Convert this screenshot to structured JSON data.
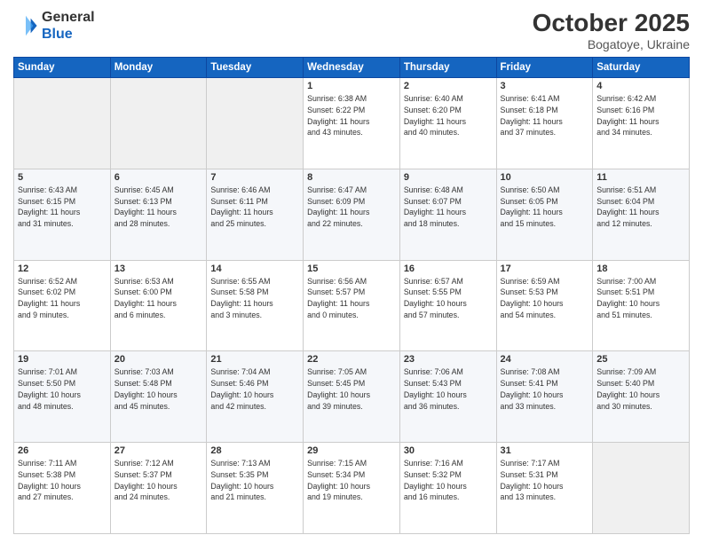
{
  "logo": {
    "line1": "General",
    "line2": "Blue"
  },
  "header": {
    "month": "October 2025",
    "location": "Bogatoye, Ukraine"
  },
  "weekdays": [
    "Sunday",
    "Monday",
    "Tuesday",
    "Wednesday",
    "Thursday",
    "Friday",
    "Saturday"
  ],
  "weeks": [
    [
      {
        "day": "",
        "text": ""
      },
      {
        "day": "",
        "text": ""
      },
      {
        "day": "",
        "text": ""
      },
      {
        "day": "1",
        "text": "Sunrise: 6:38 AM\nSunset: 6:22 PM\nDaylight: 11 hours\nand 43 minutes."
      },
      {
        "day": "2",
        "text": "Sunrise: 6:40 AM\nSunset: 6:20 PM\nDaylight: 11 hours\nand 40 minutes."
      },
      {
        "day": "3",
        "text": "Sunrise: 6:41 AM\nSunset: 6:18 PM\nDaylight: 11 hours\nand 37 minutes."
      },
      {
        "day": "4",
        "text": "Sunrise: 6:42 AM\nSunset: 6:16 PM\nDaylight: 11 hours\nand 34 minutes."
      }
    ],
    [
      {
        "day": "5",
        "text": "Sunrise: 6:43 AM\nSunset: 6:15 PM\nDaylight: 11 hours\nand 31 minutes."
      },
      {
        "day": "6",
        "text": "Sunrise: 6:45 AM\nSunset: 6:13 PM\nDaylight: 11 hours\nand 28 minutes."
      },
      {
        "day": "7",
        "text": "Sunrise: 6:46 AM\nSunset: 6:11 PM\nDaylight: 11 hours\nand 25 minutes."
      },
      {
        "day": "8",
        "text": "Sunrise: 6:47 AM\nSunset: 6:09 PM\nDaylight: 11 hours\nand 22 minutes."
      },
      {
        "day": "9",
        "text": "Sunrise: 6:48 AM\nSunset: 6:07 PM\nDaylight: 11 hours\nand 18 minutes."
      },
      {
        "day": "10",
        "text": "Sunrise: 6:50 AM\nSunset: 6:05 PM\nDaylight: 11 hours\nand 15 minutes."
      },
      {
        "day": "11",
        "text": "Sunrise: 6:51 AM\nSunset: 6:04 PM\nDaylight: 11 hours\nand 12 minutes."
      }
    ],
    [
      {
        "day": "12",
        "text": "Sunrise: 6:52 AM\nSunset: 6:02 PM\nDaylight: 11 hours\nand 9 minutes."
      },
      {
        "day": "13",
        "text": "Sunrise: 6:53 AM\nSunset: 6:00 PM\nDaylight: 11 hours\nand 6 minutes."
      },
      {
        "day": "14",
        "text": "Sunrise: 6:55 AM\nSunset: 5:58 PM\nDaylight: 11 hours\nand 3 minutes."
      },
      {
        "day": "15",
        "text": "Sunrise: 6:56 AM\nSunset: 5:57 PM\nDaylight: 11 hours\nand 0 minutes."
      },
      {
        "day": "16",
        "text": "Sunrise: 6:57 AM\nSunset: 5:55 PM\nDaylight: 10 hours\nand 57 minutes."
      },
      {
        "day": "17",
        "text": "Sunrise: 6:59 AM\nSunset: 5:53 PM\nDaylight: 10 hours\nand 54 minutes."
      },
      {
        "day": "18",
        "text": "Sunrise: 7:00 AM\nSunset: 5:51 PM\nDaylight: 10 hours\nand 51 minutes."
      }
    ],
    [
      {
        "day": "19",
        "text": "Sunrise: 7:01 AM\nSunset: 5:50 PM\nDaylight: 10 hours\nand 48 minutes."
      },
      {
        "day": "20",
        "text": "Sunrise: 7:03 AM\nSunset: 5:48 PM\nDaylight: 10 hours\nand 45 minutes."
      },
      {
        "day": "21",
        "text": "Sunrise: 7:04 AM\nSunset: 5:46 PM\nDaylight: 10 hours\nand 42 minutes."
      },
      {
        "day": "22",
        "text": "Sunrise: 7:05 AM\nSunset: 5:45 PM\nDaylight: 10 hours\nand 39 minutes."
      },
      {
        "day": "23",
        "text": "Sunrise: 7:06 AM\nSunset: 5:43 PM\nDaylight: 10 hours\nand 36 minutes."
      },
      {
        "day": "24",
        "text": "Sunrise: 7:08 AM\nSunset: 5:41 PM\nDaylight: 10 hours\nand 33 minutes."
      },
      {
        "day": "25",
        "text": "Sunrise: 7:09 AM\nSunset: 5:40 PM\nDaylight: 10 hours\nand 30 minutes."
      }
    ],
    [
      {
        "day": "26",
        "text": "Sunrise: 7:11 AM\nSunset: 5:38 PM\nDaylight: 10 hours\nand 27 minutes."
      },
      {
        "day": "27",
        "text": "Sunrise: 7:12 AM\nSunset: 5:37 PM\nDaylight: 10 hours\nand 24 minutes."
      },
      {
        "day": "28",
        "text": "Sunrise: 7:13 AM\nSunset: 5:35 PM\nDaylight: 10 hours\nand 21 minutes."
      },
      {
        "day": "29",
        "text": "Sunrise: 7:15 AM\nSunset: 5:34 PM\nDaylight: 10 hours\nand 19 minutes."
      },
      {
        "day": "30",
        "text": "Sunrise: 7:16 AM\nSunset: 5:32 PM\nDaylight: 10 hours\nand 16 minutes."
      },
      {
        "day": "31",
        "text": "Sunrise: 7:17 AM\nSunset: 5:31 PM\nDaylight: 10 hours\nand 13 minutes."
      },
      {
        "day": "",
        "text": ""
      }
    ]
  ]
}
